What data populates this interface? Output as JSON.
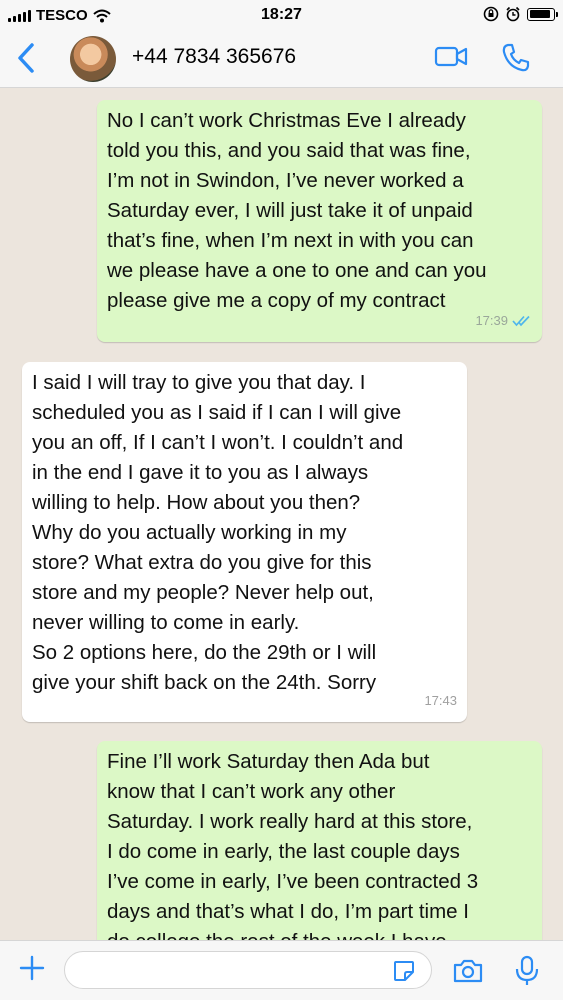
{
  "status_bar": {
    "carrier": "TESCO",
    "time": "18:27"
  },
  "header": {
    "contact_name": "+44 7834 365676",
    "back_icon": "chevron-left-icon",
    "video_icon": "video-camera-icon",
    "phone_icon": "phone-icon"
  },
  "messages": [
    {
      "direction": "outgoing",
      "lines": [
        "No I can’t work Christmas Eve I already",
        "told you this, and you said that was fine,",
        "I’m not in Swindon, I’ve never worked a",
        "Saturday ever, I will just take it of unpaid",
        "that’s fine, when I’m next in with you can",
        "we please have a one to one and can you",
        "please give me a copy of my contract"
      ],
      "time": "17:39",
      "status": "read"
    },
    {
      "direction": "incoming",
      "lines": [
        "I said I will tray to give you that day. I",
        "scheduled you as I said if I can I will give",
        "you an off, If I can’t I won’t. I couldn’t and",
        "in the end I gave it to you as I always",
        "willing to help. How about you then?",
        "Why do you actually working in my",
        "store? What extra do you give for this",
        "store and my people? Never help out,",
        "never willing to come in early.",
        "So 2 options here, do the 29th or I will",
        "give your shift back on the 24th. Sorry"
      ],
      "time": "17:43"
    },
    {
      "direction": "outgoing",
      "lines": [
        "Fine I’ll work Saturday then Ada but",
        "know that I can’t work any other",
        "Saturday. I work really hard at this store,",
        "I do come in early, the last couple days",
        "I’ve come in early, I’ve been contracted 3",
        "days and that’s what I do, I’m part time I",
        "do college the rest of the week I have"
      ]
    }
  ],
  "input_bar": {
    "placeholder": "",
    "colors": {
      "accent": "#2c8cf4"
    }
  },
  "colors": {
    "outgoing_bubble": "#dcf8c6",
    "incoming_bubble": "#ffffff",
    "chat_background": "#ece5dd",
    "read_ticks": "#4fb6ec"
  }
}
